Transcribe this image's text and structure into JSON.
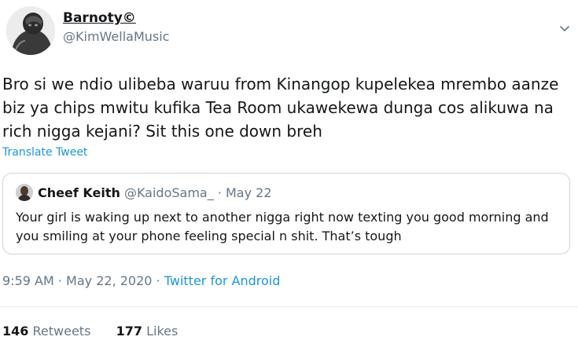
{
  "tweet": {
    "author": {
      "display_name": "Barnoty©",
      "handle": "@KimWellaMusic"
    },
    "text": "Bro si we ndio ulibeba waruu from Kinangop kupelekea mrembo aanze biz ya chips mwitu kufika Tea Room ukawekewa dunga cos alikuwa na rich nigga kejani? Sit this one down breh",
    "translate_label": "Translate Tweet",
    "quoted": {
      "display_name": "Cheef Keith",
      "handle": "@KaidoSama_",
      "separator": "·",
      "date": "May 22",
      "text": "Your girl is waking up next to another nigga right now texting you good morning and you smiling at your phone feeling special n shit. That’s tough"
    },
    "meta": {
      "time": "9:59 AM",
      "sep1": "·",
      "date": "May 22, 2020",
      "sep2": "·",
      "source": "Twitter for Android"
    },
    "stats": {
      "retweets_count": "146",
      "retweets_label": "Retweets",
      "likes_count": "177",
      "likes_label": "Likes"
    }
  },
  "icons": {
    "more": "chevron-down-icon"
  },
  "colors": {
    "text": "#14171a",
    "muted": "#657786",
    "link": "#1b95e0",
    "border": "#ccd6dd"
  }
}
